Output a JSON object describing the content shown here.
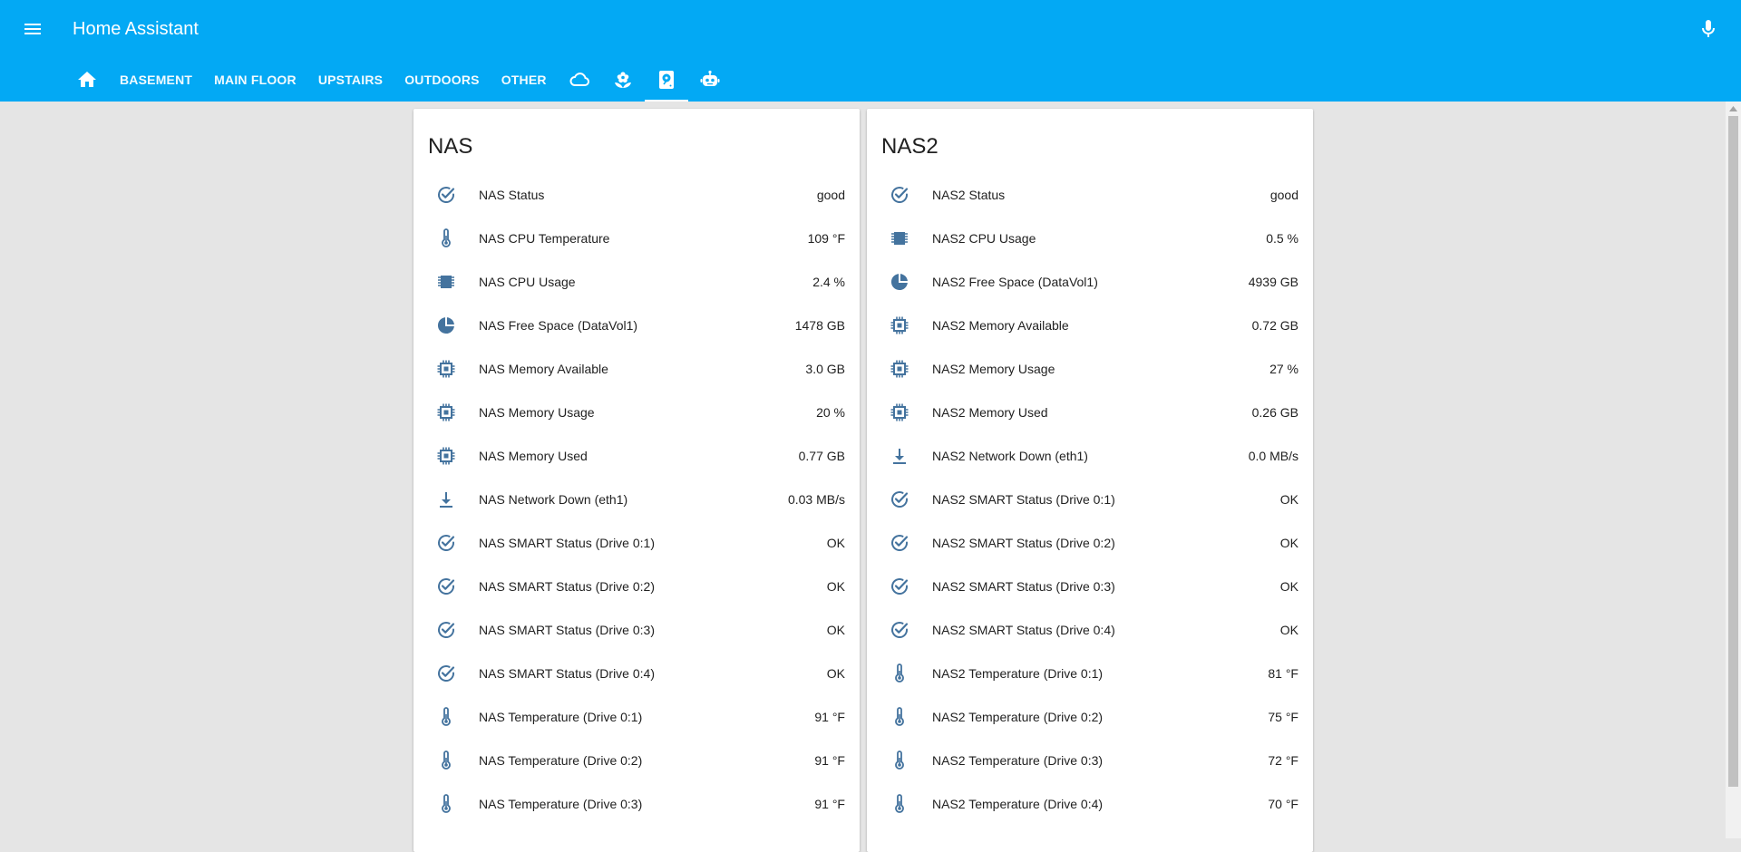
{
  "header": {
    "title": "Home Assistant",
    "menu_icon": "menu-icon",
    "mic_icon": "microphone-icon"
  },
  "tabs": [
    {
      "type": "icon",
      "icon": "home-icon"
    },
    {
      "type": "text",
      "label": "BASEMENT"
    },
    {
      "type": "text",
      "label": "MAIN FLOOR"
    },
    {
      "type": "text",
      "label": "UPSTAIRS"
    },
    {
      "type": "text",
      "label": "OUTDOORS"
    },
    {
      "type": "text",
      "label": "OTHER"
    },
    {
      "type": "icon",
      "icon": "cloud-icon"
    },
    {
      "type": "icon",
      "icon": "flower-icon"
    },
    {
      "type": "icon",
      "icon": "harddisk-icon",
      "active": true
    },
    {
      "type": "icon",
      "icon": "robot-icon"
    }
  ],
  "colors": {
    "header": "#03a9f4",
    "icon": "#44739e",
    "background": "#e5e5e5"
  },
  "cards": [
    {
      "title": "NAS",
      "rows": [
        {
          "icon": "check-circle-icon",
          "name": "NAS Status",
          "state": "good"
        },
        {
          "icon": "thermometer-icon",
          "name": "NAS CPU Temperature",
          "state": "109 °F"
        },
        {
          "icon": "chip-icon",
          "name": "NAS CPU Usage",
          "state": "2.4 %"
        },
        {
          "icon": "chart-pie-icon",
          "name": "NAS Free Space (DataVol1)",
          "state": "1478 GB"
        },
        {
          "icon": "memory-icon",
          "name": "NAS Memory Available",
          "state": "3.0 GB"
        },
        {
          "icon": "memory-icon",
          "name": "NAS Memory Usage",
          "state": "20 %"
        },
        {
          "icon": "memory-icon",
          "name": "NAS Memory Used",
          "state": "0.77 GB"
        },
        {
          "icon": "download-icon",
          "name": "NAS Network Down (eth1)",
          "state": "0.03 MB/s"
        },
        {
          "icon": "check-circle-icon",
          "name": "NAS SMART Status (Drive 0:1)",
          "state": "OK"
        },
        {
          "icon": "check-circle-icon",
          "name": "NAS SMART Status (Drive 0:2)",
          "state": "OK"
        },
        {
          "icon": "check-circle-icon",
          "name": "NAS SMART Status (Drive 0:3)",
          "state": "OK"
        },
        {
          "icon": "check-circle-icon",
          "name": "NAS SMART Status (Drive 0:4)",
          "state": "OK"
        },
        {
          "icon": "thermometer-icon",
          "name": "NAS Temperature (Drive 0:1)",
          "state": "91 °F"
        },
        {
          "icon": "thermometer-icon",
          "name": "NAS Temperature (Drive 0:2)",
          "state": "91 °F"
        },
        {
          "icon": "thermometer-icon",
          "name": "NAS Temperature (Drive 0:3)",
          "state": "91 °F"
        }
      ]
    },
    {
      "title": "NAS2",
      "rows": [
        {
          "icon": "check-circle-icon",
          "name": "NAS2 Status",
          "state": "good"
        },
        {
          "icon": "chip-icon",
          "name": "NAS2 CPU Usage",
          "state": "0.5 %"
        },
        {
          "icon": "chart-pie-icon",
          "name": "NAS2 Free Space (DataVol1)",
          "state": "4939 GB"
        },
        {
          "icon": "memory-icon",
          "name": "NAS2 Memory Available",
          "state": "0.72 GB"
        },
        {
          "icon": "memory-icon",
          "name": "NAS2 Memory Usage",
          "state": "27 %"
        },
        {
          "icon": "memory-icon",
          "name": "NAS2 Memory Used",
          "state": "0.26 GB"
        },
        {
          "icon": "download-icon",
          "name": "NAS2 Network Down (eth1)",
          "state": "0.0 MB/s"
        },
        {
          "icon": "check-circle-icon",
          "name": "NAS2 SMART Status (Drive 0:1)",
          "state": "OK"
        },
        {
          "icon": "check-circle-icon",
          "name": "NAS2 SMART Status (Drive 0:2)",
          "state": "OK"
        },
        {
          "icon": "check-circle-icon",
          "name": "NAS2 SMART Status (Drive 0:3)",
          "state": "OK"
        },
        {
          "icon": "check-circle-icon",
          "name": "NAS2 SMART Status (Drive 0:4)",
          "state": "OK"
        },
        {
          "icon": "thermometer-icon",
          "name": "NAS2 Temperature (Drive 0:1)",
          "state": "81 °F"
        },
        {
          "icon": "thermometer-icon",
          "name": "NAS2 Temperature (Drive 0:2)",
          "state": "75 °F"
        },
        {
          "icon": "thermometer-icon",
          "name": "NAS2 Temperature (Drive 0:3)",
          "state": "72 °F"
        },
        {
          "icon": "thermometer-icon",
          "name": "NAS2 Temperature (Drive 0:4)",
          "state": "70 °F"
        }
      ]
    }
  ]
}
